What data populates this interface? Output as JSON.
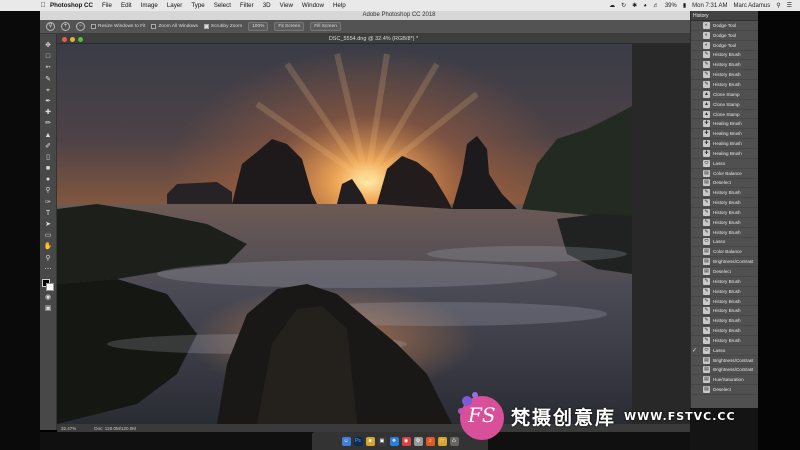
{
  "menubar": {
    "apple_icon": "apple-icon",
    "items": [
      "Photoshop CC",
      "File",
      "Edit",
      "Image",
      "Layer",
      "Type",
      "Select",
      "Filter",
      "3D",
      "View",
      "Window",
      "Help"
    ],
    "battery": "39%",
    "datetime": "Mon 7:31 AM",
    "user": "Marc Adamus"
  },
  "app": {
    "title": "Adobe Photoshop CC 2018"
  },
  "options_bar": {
    "resize_windows": "Resize Windows to Fit",
    "zoom_all": "Zoom All Windows",
    "scrubby_zoom": "Scrubby Zoom",
    "zoom_100": "100%",
    "fit_screen": "Fit Screen",
    "fill_screen": "Fill Screen"
  },
  "document": {
    "tab_title": "DSC_5554.dng @ 32.4% (RGB/8*) *",
    "zoom": "32.47%",
    "doc_size": "Doc: 120.0M/120.0M"
  },
  "history": {
    "title": "History",
    "items": [
      {
        "label": "Dodge Tool",
        "icon": "dodge-icon"
      },
      {
        "label": "Dodge Tool",
        "icon": "dodge-icon"
      },
      {
        "label": "Dodge Tool",
        "icon": "dodge-icon"
      },
      {
        "label": "History Brush",
        "icon": "history-brush-icon"
      },
      {
        "label": "History Brush",
        "icon": "history-brush-icon"
      },
      {
        "label": "History Brush",
        "icon": "history-brush-icon"
      },
      {
        "label": "History Brush",
        "icon": "history-brush-icon"
      },
      {
        "label": "Clone Stamp",
        "icon": "stamp-icon"
      },
      {
        "label": "Clone Stamp",
        "icon": "stamp-icon"
      },
      {
        "label": "Clone Stamp",
        "icon": "stamp-icon"
      },
      {
        "label": "Healing Brush",
        "icon": "healing-icon"
      },
      {
        "label": "Healing Brush",
        "icon": "healing-icon"
      },
      {
        "label": "Healing Brush",
        "icon": "healing-icon"
      },
      {
        "label": "Healing Brush",
        "icon": "healing-icon"
      },
      {
        "label": "Lasso",
        "icon": "lasso-icon"
      },
      {
        "label": "Color Balance",
        "icon": "adjust-icon"
      },
      {
        "label": "Deselect",
        "icon": "adjust-icon"
      },
      {
        "label": "History Brush",
        "icon": "history-brush-icon"
      },
      {
        "label": "History Brush",
        "icon": "history-brush-icon"
      },
      {
        "label": "History Brush",
        "icon": "history-brush-icon"
      },
      {
        "label": "History Brush",
        "icon": "history-brush-icon"
      },
      {
        "label": "History Brush",
        "icon": "history-brush-icon"
      },
      {
        "label": "Lasso",
        "icon": "lasso-icon"
      },
      {
        "label": "Color Balance",
        "icon": "adjust-icon"
      },
      {
        "label": "Brightness/Contrast",
        "icon": "adjust-icon"
      },
      {
        "label": "Deselect",
        "icon": "adjust-icon"
      },
      {
        "label": "History Brush",
        "icon": "history-brush-icon"
      },
      {
        "label": "History Brush",
        "icon": "history-brush-icon"
      },
      {
        "label": "History Brush",
        "icon": "history-brush-icon"
      },
      {
        "label": "History Brush",
        "icon": "history-brush-icon"
      },
      {
        "label": "History Brush",
        "icon": "history-brush-icon"
      },
      {
        "label": "History Brush",
        "icon": "history-brush-icon"
      },
      {
        "label": "History Brush",
        "icon": "history-brush-icon"
      },
      {
        "label": "Lasso",
        "icon": "lasso-icon"
      },
      {
        "label": "Brightness/Contrast",
        "icon": "adjust-icon"
      },
      {
        "label": "Brightness/Contrast",
        "icon": "adjust-icon"
      },
      {
        "label": "Hue/Saturation",
        "icon": "adjust-icon"
      },
      {
        "label": "Deselect",
        "icon": "adjust-icon"
      }
    ]
  },
  "watermark": {
    "brand": "梵摄创意库",
    "url": "WWW.FSTVC.CC",
    "logo_text": "FS"
  }
}
